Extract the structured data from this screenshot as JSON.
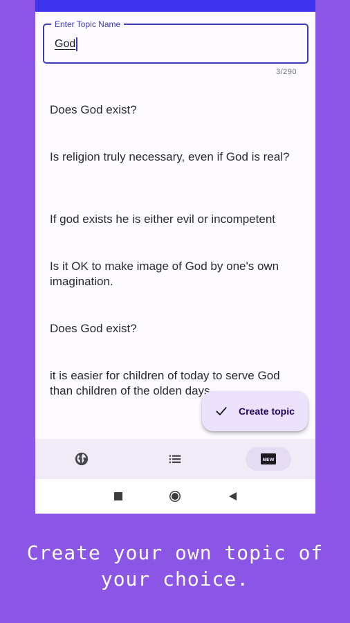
{
  "topic_field": {
    "label": "Enter Topic Name",
    "value": "God",
    "char_count": "3/290"
  },
  "topics": [
    "Does God exist?",
    "Is religion truly necessary, even if God is real?",
    "If god exists he is either evil or incompetent",
    "Is it OK to make image of God by one's own imagination.",
    "Does God exist?",
    "it is easier for children of today to serve God than children of the olden days"
  ],
  "fab": {
    "label": "Create topic"
  },
  "bottom_nav": {
    "items": [
      {
        "icon": "globe-icon"
      },
      {
        "icon": "list-icon"
      },
      {
        "icon": "new-icon",
        "active": true,
        "text": "NEW"
      }
    ]
  },
  "caption": "Create your own topic of your choice.",
  "colors": {
    "background": "#8b55e6",
    "status_bar": "#3d33ee",
    "accent": "#3f3bb8",
    "fab": "#ece2fb"
  }
}
